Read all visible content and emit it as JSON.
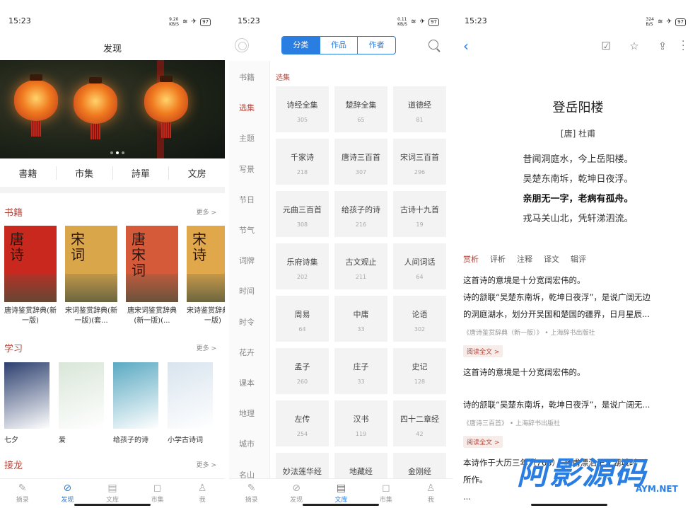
{
  "screen1": {
    "status": {
      "time": "15:23",
      "net": "9.20\nKB/S",
      "battery": "97"
    },
    "title": "发现",
    "quick_nav": [
      "書籍",
      "市集",
      "詩單",
      "文房"
    ],
    "books_section": {
      "title": "书籍",
      "more": "更多 >",
      "items": [
        {
          "cover_text": "唐诗",
          "name": "唐诗鉴赏辞典(新一版)",
          "color": "#c8281e"
        },
        {
          "cover_text": "宋词",
          "name": "宋词鉴赏辞典(新一版)(套...",
          "color": "#d9a64a"
        },
        {
          "cover_text": "唐宋词",
          "name": "唐宋词鉴赏辞典(新一版)(...",
          "color": "#d45a3a"
        },
        {
          "cover_text": "宋诗",
          "name": "宋诗鉴赏辞典(新一版)",
          "color": "#e0a84a"
        }
      ]
    },
    "learn_section": {
      "title": "学习",
      "more": "更多 >",
      "items": [
        {
          "name": "七夕",
          "color": "#2c3f6e"
        },
        {
          "name": "爱",
          "color": "#d9e6d8"
        },
        {
          "name": "给孩子的诗",
          "color": "#5aa9c2"
        },
        {
          "name": "小学古诗词",
          "color": "#d8e4ee"
        }
      ]
    },
    "third_section": {
      "title": "接龙",
      "more": "更多 >"
    },
    "tabs": [
      {
        "icon": "quill-icon",
        "glyph": "✎",
        "label": "摘录"
      },
      {
        "icon": "compass-icon",
        "glyph": "⊘",
        "label": "发现"
      },
      {
        "icon": "books-icon",
        "glyph": "▤",
        "label": "文库"
      },
      {
        "icon": "bag-icon",
        "glyph": "◻",
        "label": "市集"
      },
      {
        "icon": "person-icon",
        "glyph": "♙",
        "label": "我"
      }
    ],
    "active_tab": 1
  },
  "screen2": {
    "status": {
      "time": "15:23",
      "net": "0.11\nKB/S",
      "battery": "97"
    },
    "segments": [
      "分类",
      "作品",
      "作者"
    ],
    "selected_segment": 0,
    "categories": [
      "书籍",
      "选集",
      "主题",
      "写景",
      "节日",
      "节气",
      "词牌",
      "时间",
      "时令",
      "花卉",
      "课本",
      "地理",
      "城市",
      "名山"
    ],
    "selected_category": 1,
    "grid_label": "选集",
    "grid": [
      {
        "name": "诗经全集",
        "count": "305"
      },
      {
        "name": "楚辞全集",
        "count": "65"
      },
      {
        "name": "道德经",
        "count": "81"
      },
      {
        "name": "千家诗",
        "count": "218"
      },
      {
        "name": "唐诗三百首",
        "count": "307"
      },
      {
        "name": "宋词三百首",
        "count": "296"
      },
      {
        "name": "元曲三百首",
        "count": "308"
      },
      {
        "name": "给孩子的诗",
        "count": "216"
      },
      {
        "name": "古诗十九首",
        "count": "19"
      },
      {
        "name": "乐府诗集",
        "count": "202"
      },
      {
        "name": "古文观止",
        "count": "211"
      },
      {
        "name": "人间词话",
        "count": "64"
      },
      {
        "name": "周易",
        "count": "64"
      },
      {
        "name": "中庸",
        "count": "33"
      },
      {
        "name": "论语",
        "count": "302"
      },
      {
        "name": "孟子",
        "count": "260"
      },
      {
        "name": "庄子",
        "count": "33"
      },
      {
        "name": "史记",
        "count": "128"
      },
      {
        "name": "左传",
        "count": "254"
      },
      {
        "name": "汉书",
        "count": "119"
      },
      {
        "name": "四十二章经",
        "count": "42"
      },
      {
        "name": "妙法莲华经",
        "count": ""
      },
      {
        "name": "地藏经",
        "count": ""
      },
      {
        "name": "金刚经",
        "count": ""
      }
    ],
    "tabs": [
      {
        "icon": "quill-icon",
        "glyph": "✎",
        "label": "摘录"
      },
      {
        "icon": "compass-icon",
        "glyph": "⊘",
        "label": "发现"
      },
      {
        "icon": "books-icon",
        "glyph": "▤",
        "label": "文库"
      },
      {
        "icon": "bag-icon",
        "glyph": "◻",
        "label": "市集"
      },
      {
        "icon": "person-icon",
        "glyph": "♙",
        "label": "我"
      }
    ],
    "active_tab": 2
  },
  "screen3": {
    "status": {
      "time": "15:23",
      "net": "324\nB/S",
      "battery": "97"
    },
    "poem": {
      "title": "登岳阳楼",
      "author": "[唐] 杜甫",
      "lines": [
        "昔闻洞庭水，今上岳阳楼。",
        "吴楚东南坼，乾坤日夜浮。",
        "亲朋无一字，老病有孤舟。",
        "戎马关山北，凭轩涕泗流。"
      ],
      "bold_line": 2
    },
    "content_tabs": [
      "赏析",
      "评析",
      "注释",
      "译文",
      "辑评"
    ],
    "selected_content_tab": 0,
    "block1": {
      "intro": "这首诗的意境是十分宽阔宏伟的。",
      "text1": "诗的颔联“吴楚东南坼，乾坤日夜浮”，是说广阔无边",
      "text2": "的洞庭湖水，划分开吴国和楚国的疆界，日月星辰...",
      "source": "《唐诗鉴赏辞典（新一版）》 • 上海辞书出版社",
      "read_more": "阅读全文 >"
    },
    "block2": {
      "intro": "这首诗的意境是十分宽阔宏伟的。",
      "text1": "诗的颔联“吴楚东南坼，乾坤日夜浮”，是说广阔无...",
      "source": "《唐诗三百首》 • 上海辞书出版社",
      "read_more": "阅读全文 >"
    },
    "block3": {
      "text1": "本诗作于大历三年（768），杜甫漂泊于江湖城时",
      "text2": "所作。",
      "text3": "..."
    },
    "watermark": "阿影源码",
    "watermark_sub": "AYM.NET"
  }
}
